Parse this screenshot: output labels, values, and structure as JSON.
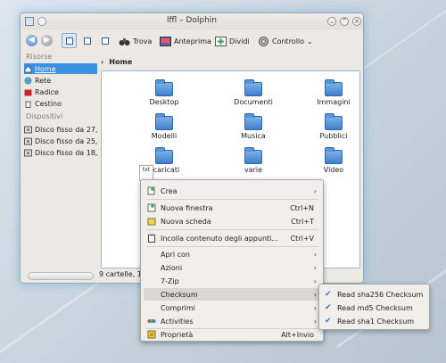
{
  "window": {
    "title": "lffl – Dolphin",
    "controls": [
      "minimize",
      "maximize",
      "close"
    ]
  },
  "toolbar": {
    "back_icon": "arrow-left-icon",
    "forward_icon": "arrow-right-icon",
    "find_label": "Trova",
    "preview_label": "Anteprima",
    "split_label": "Dividi",
    "control_label": "Controllo"
  },
  "sidebar": {
    "places_title": "Risorse",
    "places": [
      {
        "label": "Home",
        "icon": "home-icon",
        "selected": true
      },
      {
        "label": "Rete",
        "icon": "network-icon"
      },
      {
        "label": "Radice",
        "icon": "root-folder-icon"
      },
      {
        "label": "Cestino",
        "icon": "trash-icon"
      }
    ],
    "devices_title": "Dispositivi",
    "devices": [
      {
        "label": "Disco fisso da 27,",
        "icon": "hard-disk-icon"
      },
      {
        "label": "Disco fisso da 25,",
        "icon": "hard-disk-icon"
      },
      {
        "label": "Disco fisso da 18,",
        "icon": "hard-disk-icon"
      }
    ]
  },
  "breadcrumb": {
    "separator": "›",
    "current": "Home"
  },
  "files": {
    "folders": [
      "Desktop",
      "Documenti",
      "Immagini",
      "Modelli",
      "Musica",
      "Pubblici",
      "Scaricati",
      "varie",
      "Video"
    ],
    "file_icon_text": "txt"
  },
  "status": {
    "text": "9 cartelle, 1"
  },
  "context_menu": {
    "items": [
      {
        "label": "Crea",
        "submenu": true,
        "icon": "create-new-icon"
      },
      {
        "label": "Nuova finestra",
        "shortcut": "Ctrl+N",
        "icon": "new-window-icon"
      },
      {
        "label": "Nuova scheda",
        "shortcut": "Ctrl+T",
        "icon": "new-tab-icon"
      },
      {
        "label": "Incolla contenuto degli appunti...",
        "shortcut": "Ctrl+V",
        "icon": "paste-icon"
      },
      {
        "label": "Apri con",
        "submenu": true
      },
      {
        "label": "Azioni",
        "submenu": true
      },
      {
        "label": "7-Zip",
        "submenu": true
      },
      {
        "label": "Checksum",
        "submenu": true,
        "highlighted": true
      },
      {
        "label": "Comprimi",
        "submenu": true
      },
      {
        "label": "Activities",
        "submenu": true,
        "icon": "activities-icon"
      },
      {
        "label": "Proprietà",
        "shortcut": "Alt+Invio",
        "icon": "properties-icon"
      }
    ]
  },
  "checksum_submenu": {
    "items": [
      {
        "label": "Read sha256 Checksum",
        "icon": "check-icon"
      },
      {
        "label": "Read md5 Checksum",
        "icon": "check-icon"
      },
      {
        "label": "Read sha1 Checksum",
        "icon": "check-icon"
      }
    ]
  },
  "colors": {
    "selection": "#3d8fe0",
    "folder": "#3f7fca",
    "window_glow": "#5aa0dc"
  }
}
